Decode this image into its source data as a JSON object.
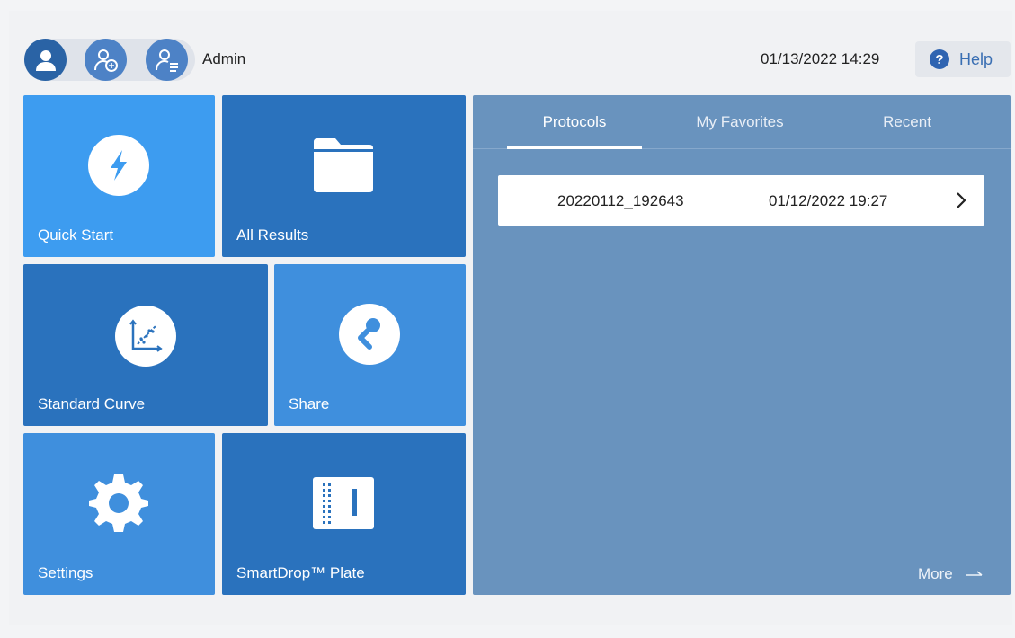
{
  "header": {
    "user_name": "Admin",
    "datetime": "01/13/2022 14:29",
    "help_label": "Help",
    "help_glyph": "?"
  },
  "tiles": {
    "quick_start": "Quick Start",
    "all_results": "All Results",
    "standard_curve": "Standard Curve",
    "share": "Share",
    "settings": "Settings",
    "smartdrop_plate": "SmartDrop™ Plate"
  },
  "panel": {
    "tabs": [
      {
        "label": "Protocols",
        "active": true
      },
      {
        "label": "My Favorites",
        "active": false
      },
      {
        "label": "Recent",
        "active": false
      }
    ],
    "rows": [
      {
        "name": "20220112_192643",
        "date": "01/12/2022 19:27"
      }
    ],
    "more_label": "More"
  },
  "colors": {
    "accent_dark": "#2a72bd",
    "accent_light": "#3d9cf0",
    "panel": "#6993be"
  }
}
